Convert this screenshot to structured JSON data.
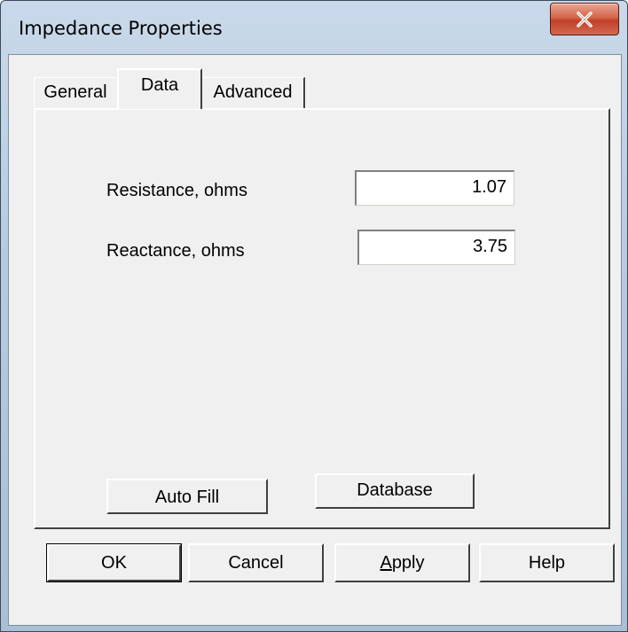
{
  "window": {
    "title": "Impedance Properties",
    "close_label": "X"
  },
  "tabs": [
    {
      "label": "General",
      "selected": false
    },
    {
      "label": "Data",
      "selected": true
    },
    {
      "label": "Advanced",
      "selected": false
    }
  ],
  "fields": {
    "resistance": {
      "label": "Resistance, ohms",
      "value": "1.07"
    },
    "reactance": {
      "label": "Reactance, ohms",
      "value": "3.75"
    }
  },
  "panel_buttons": {
    "auto_fill": "Auto Fill",
    "database": "Database"
  },
  "dialog_buttons": {
    "ok": "OK",
    "cancel": "Cancel",
    "apply": "Apply",
    "help": "Help"
  },
  "colors": {
    "close_button": "#c2402a",
    "dialog_face": "#f0f0f0"
  }
}
